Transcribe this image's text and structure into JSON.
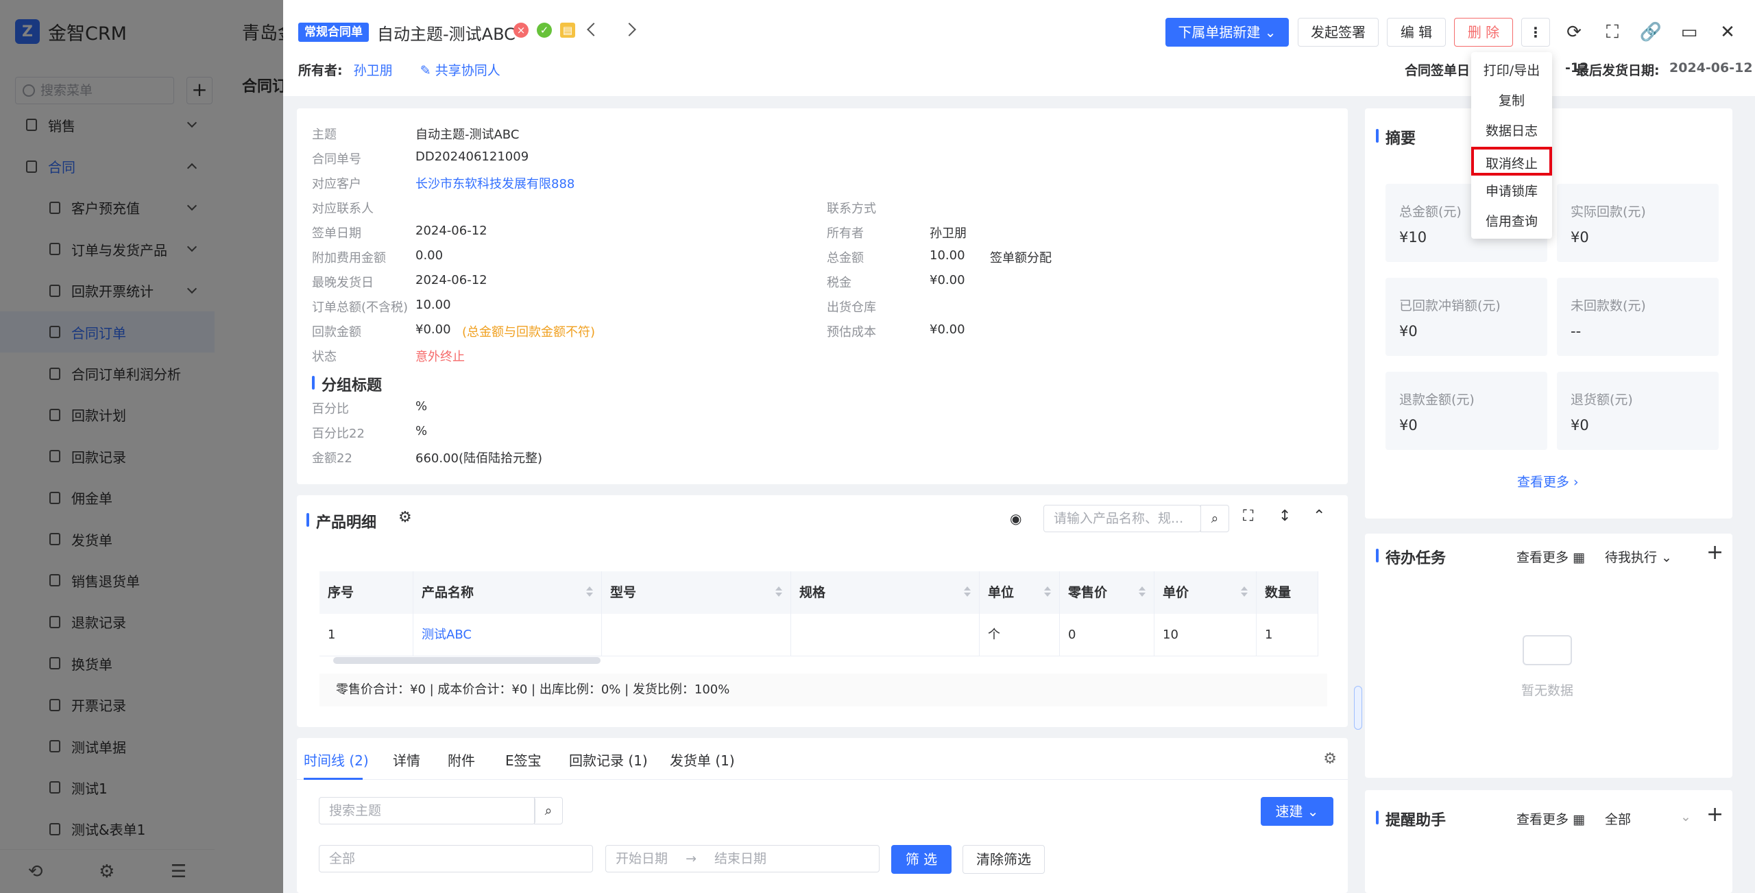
{
  "app": {
    "name": "金智CRM",
    "search_placeholder": "搜索菜单"
  },
  "menu": [
    {
      "label": "销售",
      "top": true
    },
    {
      "label": "合同",
      "top": true,
      "blue": true,
      "open": true
    },
    {
      "label": "客户预充值",
      "arrow": true
    },
    {
      "label": "订单与发货产品",
      "arrow": true
    },
    {
      "label": "回款开票统计",
      "arrow": true
    },
    {
      "label": "合同订单",
      "active": true
    },
    {
      "label": "合同订单利润分析"
    },
    {
      "label": "回款计划"
    },
    {
      "label": "回款记录"
    },
    {
      "label": "佣金单"
    },
    {
      "label": "发货单"
    },
    {
      "label": "销售退货单"
    },
    {
      "label": "退款记录"
    },
    {
      "label": "换货单"
    },
    {
      "label": "开票记录"
    },
    {
      "label": "测试单据"
    },
    {
      "label": "测试1"
    },
    {
      "label": "测试&表单1"
    }
  ],
  "bg": {
    "crumb": "青岛金",
    "tab": "合同订"
  },
  "header": {
    "tag": "常规合同单",
    "title": "自动主题-测试ABC",
    "owner_label": "所有者:",
    "owner": "孙卫朋",
    "share": "共享协同人",
    "sign_label": "合同签单日",
    "sign_value": "-12",
    "ship_label": "最后发货日期:",
    "ship_value": "2024-06-12",
    "btn_new": "下属单据新建",
    "btn_sign": "发起签署",
    "btn_edit": "编 辑",
    "btn_delete": "删 除"
  },
  "dropdown": [
    "打印/导出",
    "复制",
    "数据日志",
    "取消终止",
    "申请锁库",
    "信用查询"
  ],
  "info": {
    "left": [
      [
        "主题",
        "自动主题-测试ABC"
      ],
      [
        "合同单号",
        "DD202406121009"
      ],
      [
        "对应客户",
        "长沙市东软科技发展有限888"
      ],
      [
        "对应联系人",
        ""
      ],
      [
        "签单日期",
        "2024-06-12"
      ],
      [
        "附加费用金额",
        "0.00"
      ],
      [
        "最晚发货日",
        "2024-06-12"
      ],
      [
        "订单总额(不含税)",
        "10.00"
      ],
      [
        "回款金额",
        "¥0.00"
      ],
      [
        "状态",
        "意外终止"
      ]
    ],
    "payback_warn": "(总金额与回款金额不符)",
    "right": [
      [
        "联系方式",
        ""
      ],
      [
        "所有者",
        "孙卫朋"
      ],
      [
        "总金额",
        "10.00"
      ],
      [
        "税金",
        "¥0.00"
      ],
      [
        "出货仓库",
        ""
      ],
      [
        "预估成本",
        "¥0.00"
      ]
    ],
    "total_extra": "签单额分配",
    "group_title": "分组标题",
    "group": [
      [
        "百分比",
        "%"
      ],
      [
        "百分比22",
        "%"
      ],
      [
        "金额22",
        "660.00(陆佰陆拾元整)"
      ]
    ]
  },
  "products": {
    "title": "产品明细",
    "search_placeholder": "请输入产品名称、规...",
    "columns": [
      "序号",
      "产品名称",
      "型号",
      "规格",
      "单位",
      "零售价",
      "单价",
      "数量"
    ],
    "rows": [
      [
        "1",
        "测试ABC",
        "",
        "",
        "个",
        "0",
        "10",
        "1"
      ]
    ],
    "footer": "零售价合计：¥0 |   成本价合计：¥0 |   出库比例：0% |   发货比例：100%"
  },
  "tabs": [
    "时间线 (2)",
    "详情",
    "附件",
    "E签宝",
    "回款记录 (1)",
    "发货单 (1)"
  ],
  "timeline": {
    "search_placeholder": "搜索主题",
    "quick": "速建",
    "all": "全部",
    "start": "开始日期",
    "end": "结束日期",
    "filter": "筛 选",
    "clear": "清除筛选"
  },
  "summary": {
    "title": "摘要",
    "stats": [
      [
        "总金额(元)",
        "¥10"
      ],
      [
        "实际回款(元)",
        "¥0"
      ],
      [
        "已回款冲销额(元)",
        "¥0"
      ],
      [
        "未回款数(元)",
        "--"
      ],
      [
        "退款金额(元)",
        "¥0"
      ],
      [
        "退货额(元)",
        "¥0"
      ]
    ],
    "more": "查看更多"
  },
  "todo": {
    "title": "待办任务",
    "more": "查看更多",
    "filter": "待我执行",
    "empty": "暂无数据"
  },
  "reminder": {
    "title": "提醒助手",
    "more": "查看更多",
    "filter": "全部"
  }
}
